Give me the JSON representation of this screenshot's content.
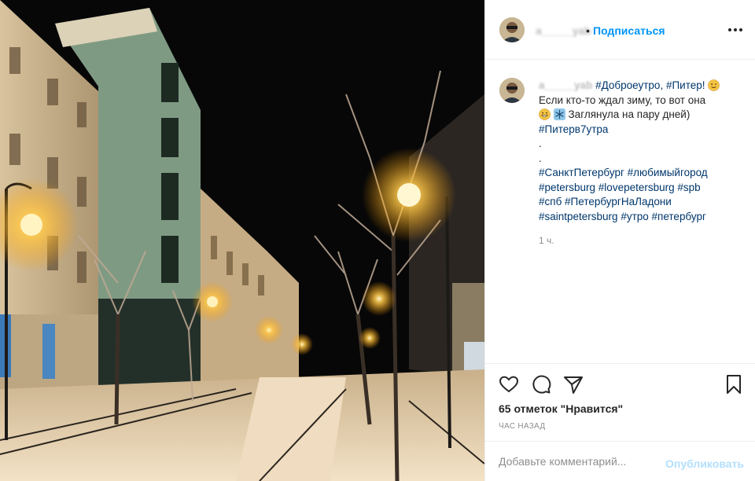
{
  "post": {
    "image_alt": "snowy street at night with lit lamps"
  },
  "header": {
    "username": "a_____yab",
    "separator": "•",
    "follow_label": "Подписаться",
    "more_icon": "more-horizontal-icon"
  },
  "caption": {
    "username": "a_____yab",
    "lines": [
      "#Доброеутро, #Питер!",
      "Если кто-то ждал зиму, то вот она",
      "Заглянула на пару дней)",
      "#Питерв7утра",
      ".",
      ".",
      "#СанктПетербург #любимыйгород",
      "#petersburg #lovepetersburg #spb",
      "#спб #ПетербургНаЛадони",
      "#saintpetersburg #утро #петербург"
    ],
    "time": "1 ч."
  },
  "actions": {
    "icons": [
      "heart-icon",
      "comment-icon",
      "share-icon",
      "bookmark-icon"
    ],
    "likes_text": "65 отметок \"Нравится\"",
    "posted_ago": "ЧАС НАЗАД"
  },
  "comment_box": {
    "placeholder": "Добавьте комментарий...",
    "publish_label": "Опубликовать"
  },
  "colors": {
    "link_blue": "#0095f6",
    "hashtag": "#00376b",
    "muted": "#8e8e8e",
    "publish_disabled": "#b2dffc"
  }
}
